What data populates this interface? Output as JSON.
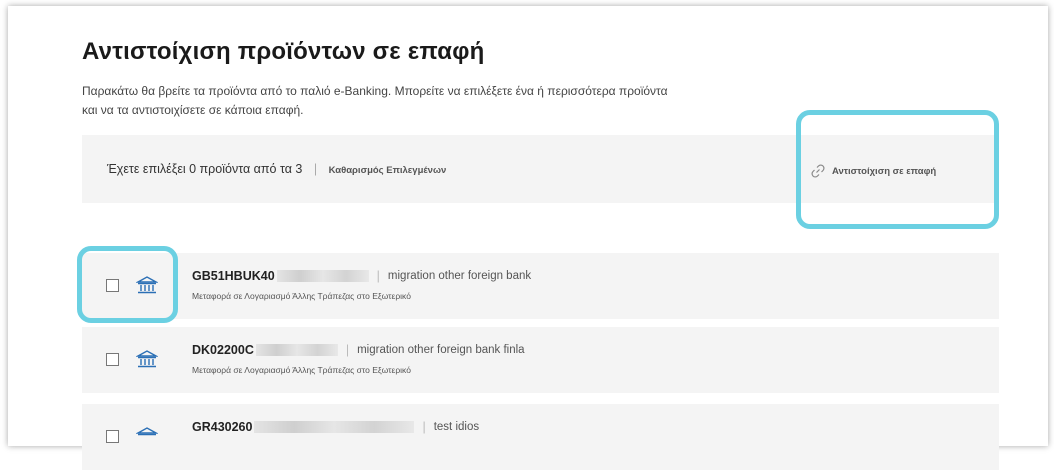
{
  "page": {
    "title": "Αντιστοίχιση προϊόντων σε επαφή",
    "description": "Παρακάτω θα βρείτε τα προϊόντα από το παλιό e-Banking. Μπορείτε να επιλέξετε ένα ή περισσότερα προϊόντα και να τα αντιστοιχίσετε σε κάποια επαφή."
  },
  "selection_bar": {
    "count_text": "Έχετε επιλέξει 0 προϊόντα από τα 3",
    "separator": "|",
    "clear_label": "Καθαρισμός Επιλεγμένων",
    "match_label": "Αντιστοίχιση σε επαφή",
    "match_icon": "link-icon"
  },
  "products": [
    {
      "account": "GB51HBUK40",
      "nickname": "migration other foreign bank",
      "subtitle": "Μεταφορά σε Λογαριασμό Άλλης Τράπεζας στο Εξωτερικό",
      "icon": "bank-icon",
      "checked": false
    },
    {
      "account": "DK02200C",
      "nickname": "migration other foreign bank finla",
      "subtitle": "Μεταφορά σε Λογαριασμό Άλλης Τράπεζας στο Εξωτερικό",
      "icon": "bank-icon",
      "checked": false
    },
    {
      "account": "GR430260",
      "nickname": "test idios",
      "subtitle": "",
      "icon": "bank-icon",
      "checked": false
    }
  ],
  "colors": {
    "highlight": "#6bd0e2",
    "bank_icon": "#2a6fb5",
    "row_bg": "#f4f4f4"
  }
}
